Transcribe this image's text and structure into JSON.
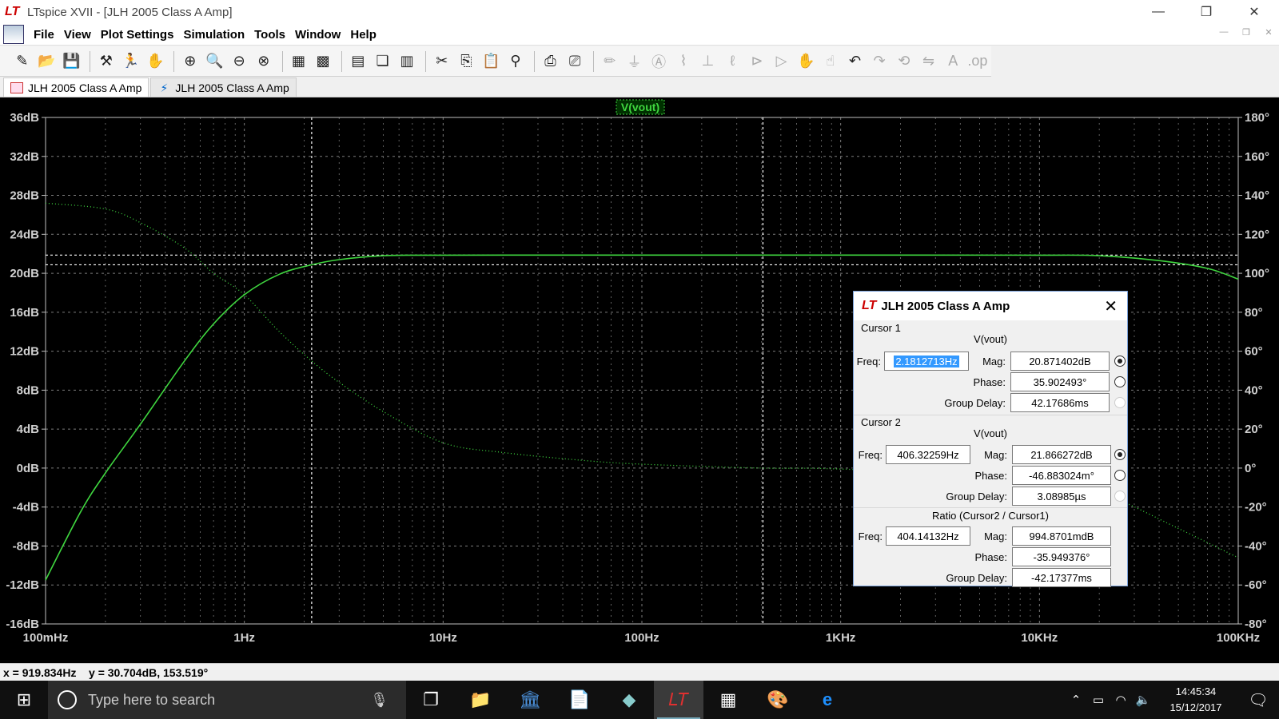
{
  "window": {
    "title": "LTspice XVII - [JLH 2005 Class A Amp]",
    "controls": {
      "minimize": "—",
      "maximize": "❐",
      "close": "✕"
    }
  },
  "menu": {
    "items": [
      "File",
      "View",
      "Plot Settings",
      "Simulation",
      "Tools",
      "Window",
      "Help"
    ]
  },
  "tabs": [
    {
      "label": "JLH 2005 Class A Amp",
      "icon": "waveform-icon",
      "active": true
    },
    {
      "label": "JLH 2005 Class A Amp",
      "icon": "schematic-icon",
      "active": false
    }
  ],
  "plot": {
    "trace_label": "V(vout)",
    "left_ticks": [
      "36dB",
      "32dB",
      "28dB",
      "24dB",
      "20dB",
      "16dB",
      "12dB",
      "8dB",
      "4dB",
      "0dB",
      "-4dB",
      "-8dB",
      "-12dB",
      "-16dB"
    ],
    "right_ticks": [
      "180°",
      "160°",
      "140°",
      "120°",
      "100°",
      "80°",
      "60°",
      "40°",
      "20°",
      "0°",
      "-20°",
      "-40°",
      "-60°",
      "-80°"
    ],
    "x_ticks": [
      "100mHz",
      "1Hz",
      "10Hz",
      "100Hz",
      "1KHz",
      "10KHz",
      "100KHz"
    ],
    "colors": {
      "background": "#000000",
      "magnitude_trace": "#3fd63f",
      "phase_trace": "#3fd63f",
      "grid": "#8a8a8a",
      "cursor": "#ffffff"
    }
  },
  "chart_data": {
    "type": "line",
    "x_scale": "log",
    "xlim": [
      0.1,
      100000
    ],
    "ylim": [
      -16,
      36
    ],
    "y2lim": [
      -80,
      180
    ],
    "grid": true,
    "series": [
      {
        "name": "V(vout)",
        "style": "solid",
        "x": [
          0.1,
          0.15,
          0.2,
          0.3,
          0.5,
          0.7,
          1,
          1.5,
          2.18,
          3,
          5,
          10,
          100,
          1000,
          10000,
          20000,
          40000,
          70000,
          100000
        ],
        "y": [
          -11.5,
          -4.5,
          -0.5,
          4.5,
          11,
          14.8,
          17.8,
          19.9,
          20.87,
          21.4,
          21.8,
          21.86,
          21.87,
          21.87,
          21.86,
          21.8,
          21.3,
          20.5,
          19.4
        ]
      },
      {
        "name": "V(vout) phase",
        "style": "dotted",
        "axis": "right",
        "x": [
          0.1,
          0.2,
          0.3,
          0.5,
          0.7,
          1,
          1.5,
          2.18,
          3,
          5,
          10,
          20,
          50,
          100,
          400,
          1000,
          10000,
          20000,
          50000,
          100000
        ],
        "y": [
          136,
          133,
          126,
          113,
          100,
          89,
          70,
          55,
          44,
          29,
          13,
          8,
          4,
          2,
          0,
          -0.5,
          -5,
          -12,
          -31,
          -46
        ]
      }
    ],
    "cursors": [
      {
        "x": 2.1812713,
        "y": 20.871402
      },
      {
        "x": 406.32259,
        "y": 21.866272
      }
    ]
  },
  "cursor_dialog": {
    "title": "JLH 2005 Class A Amp",
    "cursor1": {
      "header": "Cursor 1",
      "signal": "V(vout)",
      "freq": "2.1812713Hz",
      "mag": "20.871402dB",
      "phase": "35.902493°",
      "group_delay": "42.17686ms"
    },
    "cursor2": {
      "header": "Cursor 2",
      "signal": "V(vout)",
      "freq": "406.32259Hz",
      "mag": "21.866272dB",
      "phase": "-46.883024m°",
      "group_delay": "3.08985µs"
    },
    "ratio": {
      "header": "Ratio (Cursor2 / Cursor1)",
      "freq": "404.14132Hz",
      "mag": "994.8701mdB",
      "phase": "-35.949376°",
      "group_delay": "-42.17377ms"
    },
    "labels": {
      "freq": "Freq:",
      "mag": "Mag:",
      "phase": "Phase:",
      "group_delay": "Group Delay:"
    }
  },
  "status": {
    "text": "x = 919.834Hz    y = 30.704dB, 153.519°"
  },
  "taskbar": {
    "search_placeholder": "Type here to search",
    "time": "14:45:34",
    "date": "15/12/2017"
  }
}
